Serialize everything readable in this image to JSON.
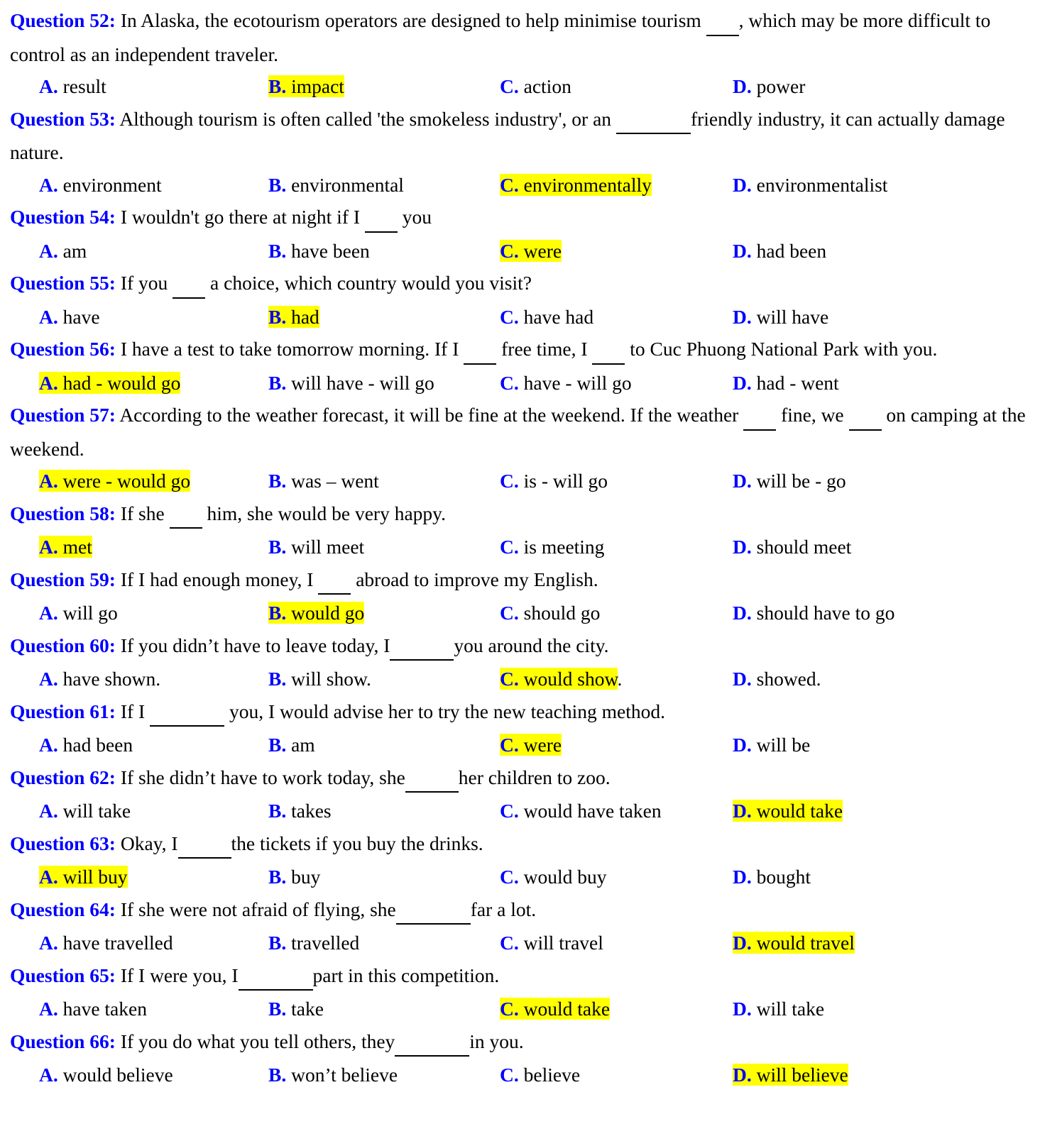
{
  "document": {
    "type": "english-grammar-multiple-choice-worksheet",
    "colors": {
      "question_label": "#0000FF",
      "option_letter": "#0000FF",
      "highlight": "#FFFF00",
      "body_text": "#000000",
      "background": "#FFFFFF"
    },
    "option_columns": [
      "A",
      "B",
      "C",
      "D"
    ]
  },
  "questions": [
    {
      "label": "Question 52:",
      "stem_parts": [
        {
          "t": "text",
          "v": " In Alaska, the ecotourism operators are designed to help minimise tourism "
        },
        {
          "t": "blank",
          "w": "w1"
        },
        {
          "t": "text",
          "v": ", which may be more difficult to control as an independent traveler."
        }
      ],
      "options": [
        {
          "letter": "A.",
          "text": " result",
          "highlighted": false
        },
        {
          "letter": "B.",
          "text": " impact",
          "highlighted": true
        },
        {
          "letter": "C.",
          "text": " action",
          "highlighted": false
        },
        {
          "letter": "D.",
          "text": " power",
          "highlighted": false
        }
      ],
      "answer": "B"
    },
    {
      "label": "Question 53:",
      "stem_parts": [
        {
          "t": "text",
          "v": " Although tourism is often called 'the smokeless industry', or an "
        },
        {
          "t": "blank",
          "w": "w5"
        },
        {
          "t": "text",
          "v": "friendly industry, it can actually damage nature."
        }
      ],
      "options": [
        {
          "letter": "A.",
          "text": " environment",
          "highlighted": false
        },
        {
          "letter": "B.",
          "text": " environmental",
          "highlighted": false
        },
        {
          "letter": "C.",
          "text": " environmentally",
          "highlighted": true
        },
        {
          "letter": "D.",
          "text": " environmentalist",
          "highlighted": false
        }
      ],
      "answer": "C"
    },
    {
      "label": "Question 54:",
      "stem_parts": [
        {
          "t": "text",
          "v": " I wouldn't go there at night if I "
        },
        {
          "t": "blank",
          "w": "w1"
        },
        {
          "t": "text",
          "v": " you"
        }
      ],
      "options": [
        {
          "letter": "A.",
          "text": " am",
          "highlighted": false
        },
        {
          "letter": "B.",
          "text": " have been",
          "highlighted": false
        },
        {
          "letter": "C.",
          "text": " were",
          "highlighted": true
        },
        {
          "letter": "D.",
          "text": " had been",
          "highlighted": false
        }
      ],
      "answer": "C"
    },
    {
      "label": "Question 55:",
      "stem_parts": [
        {
          "t": "text",
          "v": " If you "
        },
        {
          "t": "blank",
          "w": "w1"
        },
        {
          "t": "text",
          "v": " a choice, which country would you visit?"
        }
      ],
      "options": [
        {
          "letter": "A.",
          "text": " have",
          "highlighted": false
        },
        {
          "letter": "B.",
          "text": " had",
          "highlighted": true
        },
        {
          "letter": "C.",
          "text": " have had",
          "highlighted": false
        },
        {
          "letter": "D.",
          "text": " will have",
          "highlighted": false
        }
      ],
      "answer": "B"
    },
    {
      "label": "Question 56:",
      "stem_parts": [
        {
          "t": "text",
          "v": " I have a test to take tomorrow morning. If I "
        },
        {
          "t": "blank",
          "w": "w1"
        },
        {
          "t": "text",
          "v": " free time, I "
        },
        {
          "t": "blank",
          "w": "w1"
        },
        {
          "t": "text",
          "v": " to Cuc Phuong National Park with you."
        }
      ],
      "options": [
        {
          "letter": "A.",
          "text": " had - would go",
          "highlighted": true
        },
        {
          "letter": "B.",
          "text": " will have - will go",
          "highlighted": false
        },
        {
          "letter": "C.",
          "text": " have - will go",
          "highlighted": false
        },
        {
          "letter": "D.",
          "text": " had - went",
          "highlighted": false
        }
      ],
      "answer": "A"
    },
    {
      "label": "Question 57:",
      "stem_parts": [
        {
          "t": "text",
          "v": " According to the weather forecast, it will be fine at the weekend. If the weather "
        },
        {
          "t": "blank",
          "w": "w1"
        },
        {
          "t": "text",
          "v": " fine, we "
        },
        {
          "t": "blank",
          "w": "w1"
        },
        {
          "t": "text",
          "v": " on camping at the weekend."
        }
      ],
      "options": [
        {
          "letter": "A.",
          "text": " were - would go",
          "highlighted": true
        },
        {
          "letter": "B.",
          "text": " was – went",
          "highlighted": false
        },
        {
          "letter": "C.",
          "text": " is - will go",
          "highlighted": false
        },
        {
          "letter": "D.",
          "text": " will be - go",
          "highlighted": false
        }
      ],
      "answer": "A"
    },
    {
      "label": "Question 58:",
      "stem_parts": [
        {
          "t": "text",
          "v": " If she "
        },
        {
          "t": "blank",
          "w": "w1"
        },
        {
          "t": "text",
          "v": " him, she would be very happy."
        }
      ],
      "options": [
        {
          "letter": "A.",
          "text": " met",
          "highlighted": true
        },
        {
          "letter": "B.",
          "text": " will meet",
          "highlighted": false
        },
        {
          "letter": "C.",
          "text": " is meeting",
          "highlighted": false
        },
        {
          "letter": "D.",
          "text": " should meet",
          "highlighted": false
        }
      ],
      "answer": "A"
    },
    {
      "label": "Question 59:",
      "stem_parts": [
        {
          "t": "text",
          "v": " If I had enough money, I "
        },
        {
          "t": "blank",
          "w": "w1"
        },
        {
          "t": "text",
          "v": " abroad to improve my English."
        }
      ],
      "options": [
        {
          "letter": "A.",
          "text": " will go",
          "highlighted": false
        },
        {
          "letter": "B.",
          "text": " would go",
          "highlighted": true
        },
        {
          "letter": "C.",
          "text": " should go",
          "highlighted": false
        },
        {
          "letter": "D.",
          "text": " should have to go",
          "highlighted": false
        }
      ],
      "answer": "B"
    },
    {
      "label": "Question 60:",
      "stem_parts": [
        {
          "t": "text",
          "v": " If you didn’t have to leave today, I"
        },
        {
          "t": "blank",
          "w": "w4"
        },
        {
          "t": "text",
          "v": "you around the city."
        }
      ],
      "options": [
        {
          "letter": "A.",
          "text": " have shown.",
          "highlighted": false
        },
        {
          "letter": "B.",
          "text": " will show.",
          "highlighted": false
        },
        {
          "letter": "C.",
          "text": " would show",
          "trailing": ".",
          "highlighted": true
        },
        {
          "letter": "D.",
          "text": " showed.",
          "highlighted": false
        }
      ],
      "answer": "C"
    },
    {
      "label": "Question 61:",
      "stem_parts": [
        {
          "t": "text",
          "v": " If I "
        },
        {
          "t": "blank",
          "w": "w5"
        },
        {
          "t": "text",
          "v": " you, I would advise her to try the new teaching method."
        }
      ],
      "options": [
        {
          "letter": "A.",
          "text": " had been",
          "highlighted": false
        },
        {
          "letter": "B.",
          "text": " am",
          "highlighted": false
        },
        {
          "letter": "C.",
          "text": " were",
          "highlighted": true
        },
        {
          "letter": "D.",
          "text": " will be",
          "highlighted": false
        }
      ],
      "answer": "C"
    },
    {
      "label": "Question 62:",
      "stem_parts": [
        {
          "t": "text",
          "v": " If she didn’t have to work today, she"
        },
        {
          "t": "blank",
          "w": "w3"
        },
        {
          "t": "text",
          "v": "her children to zoo."
        }
      ],
      "options": [
        {
          "letter": "A.",
          "text": " will take",
          "highlighted": false
        },
        {
          "letter": "B.",
          "text": " takes",
          "highlighted": false
        },
        {
          "letter": "C.",
          "text": " would have taken",
          "highlighted": false
        },
        {
          "letter": "D.",
          "text": " would take",
          "highlighted": true
        }
      ],
      "answer": "D"
    },
    {
      "label": "Question 63:",
      "stem_parts": [
        {
          "t": "text",
          "v": " Okay, I"
        },
        {
          "t": "blank",
          "w": "w3"
        },
        {
          "t": "text",
          "v": "the tickets if you buy the drinks."
        }
      ],
      "options": [
        {
          "letter": "A.",
          "text": " will buy",
          "highlighted": true
        },
        {
          "letter": "B.",
          "text": " buy",
          "highlighted": false
        },
        {
          "letter": "C.",
          "text": " would buy",
          "highlighted": false
        },
        {
          "letter": "D.",
          "text": " bought",
          "highlighted": false
        }
      ],
      "answer": "A"
    },
    {
      "label": "Question 64:",
      "stem_parts": [
        {
          "t": "text",
          "v": " If she were not afraid of flying, she"
        },
        {
          "t": "blank",
          "w": "w5"
        },
        {
          "t": "text",
          "v": "far a lot."
        }
      ],
      "options": [
        {
          "letter": "A.",
          "text": " have travelled",
          "highlighted": false
        },
        {
          "letter": "B.",
          "text": " travelled",
          "highlighted": false
        },
        {
          "letter": "C.",
          "text": " will travel",
          "highlighted": false
        },
        {
          "letter": "D.",
          "text": " would travel",
          "highlighted": true
        }
      ],
      "answer": "D"
    },
    {
      "label": "Question 65:",
      "stem_parts": [
        {
          "t": "text",
          "v": " If I were you, I"
        },
        {
          "t": "blank",
          "w": "w5"
        },
        {
          "t": "text",
          "v": "part in this competition."
        }
      ],
      "options": [
        {
          "letter": "A.",
          "text": " have taken",
          "highlighted": false
        },
        {
          "letter": "B.",
          "text": " take",
          "highlighted": false
        },
        {
          "letter": "C.",
          "text": " would take",
          "highlighted": true
        },
        {
          "letter": "D.",
          "text": " will take",
          "highlighted": false
        }
      ],
      "answer": "C"
    },
    {
      "label": "Question 66:",
      "stem_parts": [
        {
          "t": "text",
          "v": " If you do what you tell others, they"
        },
        {
          "t": "blank",
          "w": "w5"
        },
        {
          "t": "text",
          "v": "in you."
        }
      ],
      "options": [
        {
          "letter": "A.",
          "text": " would believe",
          "highlighted": false
        },
        {
          "letter": "B.",
          "text": " won’t believe",
          "highlighted": false
        },
        {
          "letter": "C.",
          "text": " believe",
          "highlighted": false
        },
        {
          "letter": "D.",
          "text": " will believe",
          "highlighted": true
        }
      ],
      "answer": "D"
    }
  ]
}
